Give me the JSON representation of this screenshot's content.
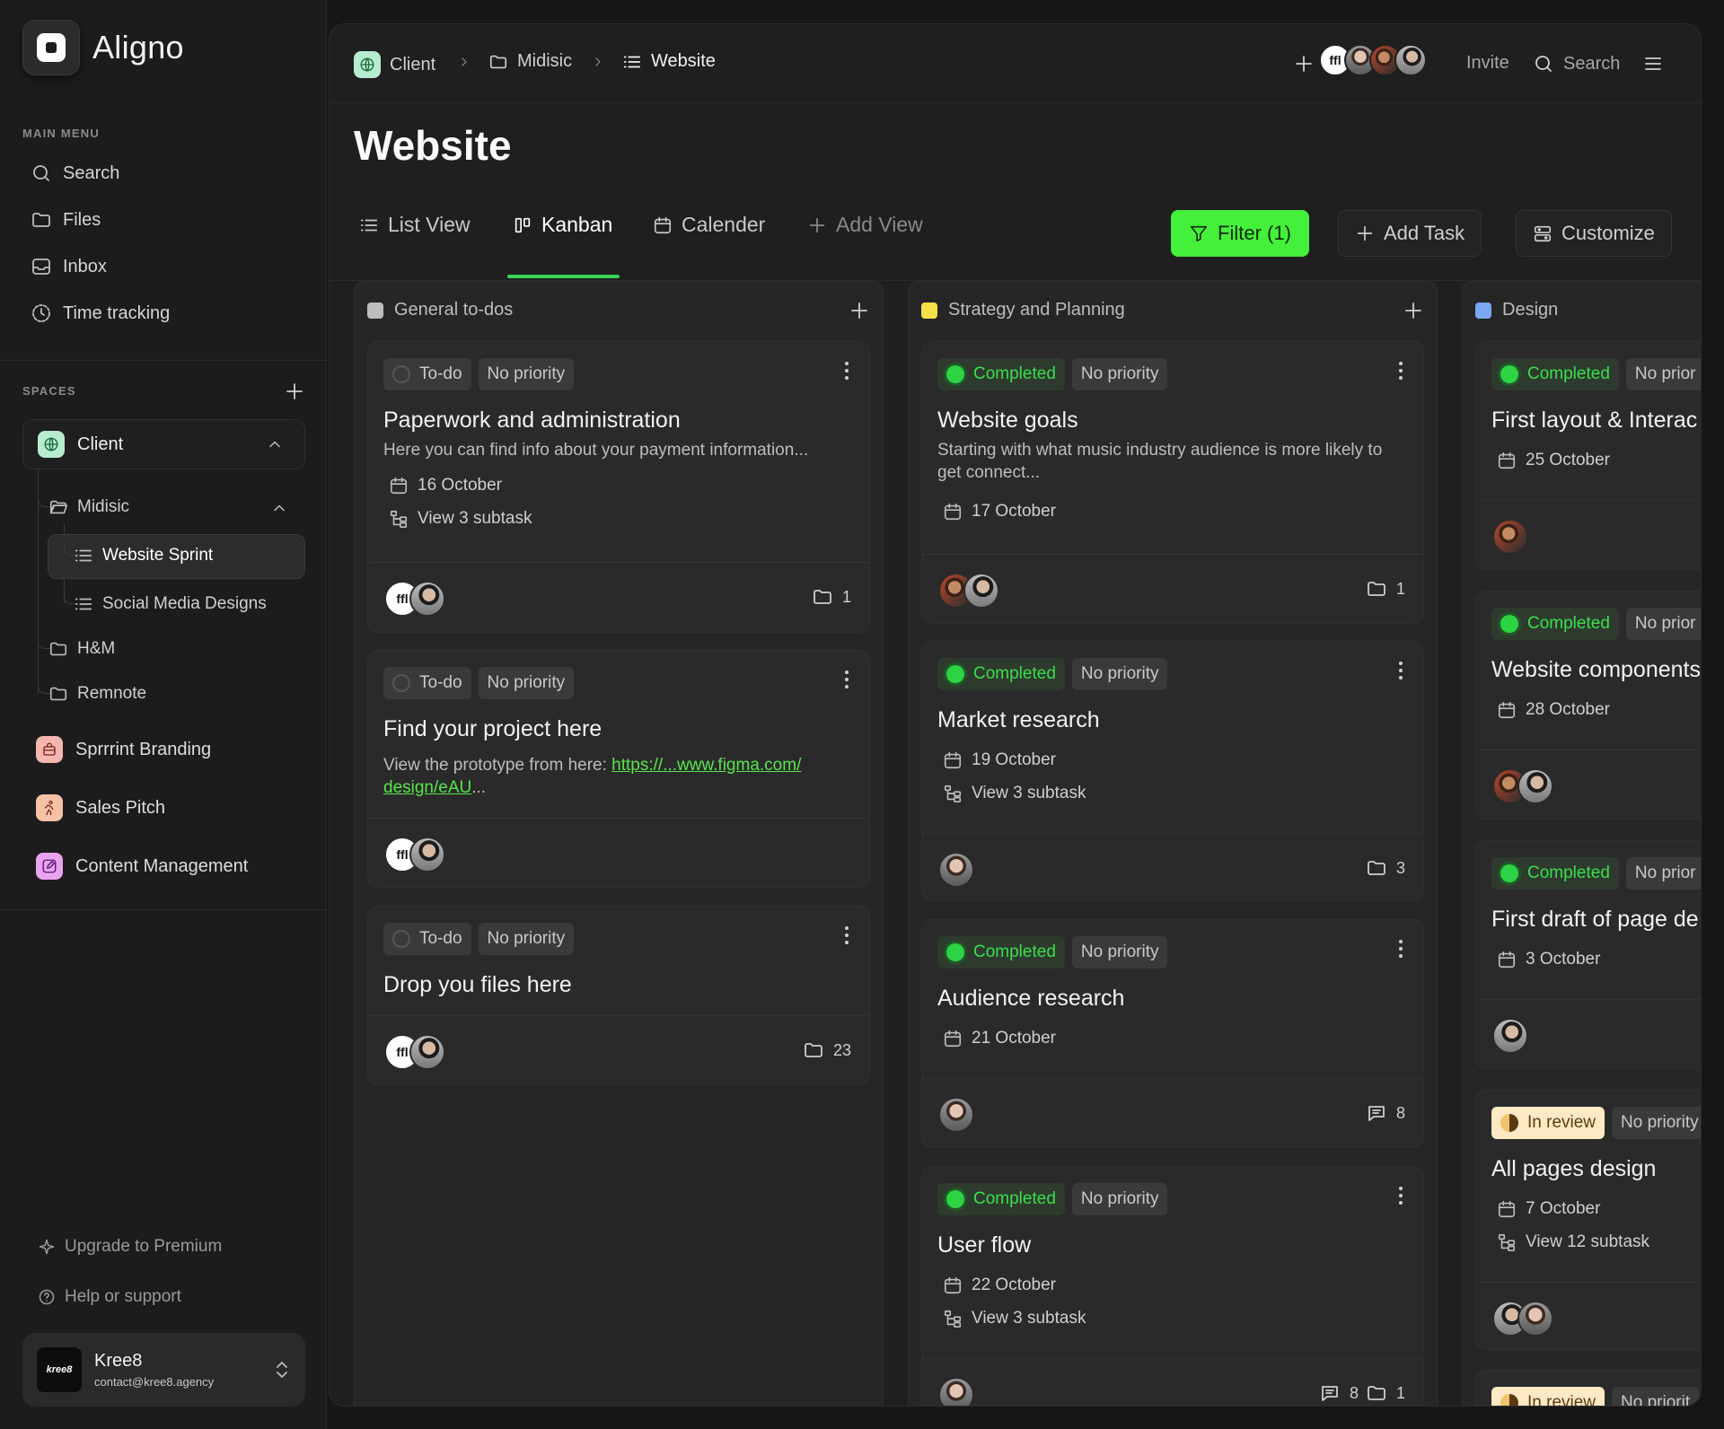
{
  "app": {
    "name": "Aligno"
  },
  "sidebar": {
    "main_menu_label": "MAIN MENU",
    "menu": [
      {
        "label": "Search",
        "icon": "search-icon"
      },
      {
        "label": "Files",
        "icon": "folder-icon"
      },
      {
        "label": "Inbox",
        "icon": "inbox-icon"
      },
      {
        "label": "Time tracking",
        "icon": "clock-icon"
      }
    ],
    "spaces_label": "SPACES",
    "client": {
      "label": "Client"
    },
    "tree": {
      "midisic": "Midisic",
      "website_sprint": "Website Sprint",
      "social_media": "Social Media Designs",
      "hm": "H&M",
      "remnote": "Remnote"
    },
    "spaces": [
      {
        "label": "Sprrrint Branding",
        "color": "#f4b6b0",
        "icon": "bag-icon"
      },
      {
        "label": "Sales Pitch",
        "color": "#f7c1a6",
        "icon": "runner-icon"
      },
      {
        "label": "Content Management",
        "color": "#e9a4f0",
        "icon": "edit-icon"
      }
    ],
    "upgrade": "Upgrade to Premium",
    "help": "Help or support",
    "account": {
      "name": "Kree8",
      "email": "contact@kree8.agency",
      "logo_text": "kree8"
    }
  },
  "topbar": {
    "breadcrumb": [
      "Client",
      "Midisic",
      "Website"
    ],
    "invite": "Invite",
    "search": "Search"
  },
  "page": {
    "title": "Website",
    "tabs": [
      "List View",
      "Kanban",
      "Calender",
      "Add View"
    ],
    "filter_label": "Filter (1)",
    "add_task_label": "Add Task",
    "customize_label": "Customize"
  },
  "columns": [
    {
      "title": "General to-dos",
      "color": "#bdbdbd",
      "cards": [
        {
          "status": "To-do",
          "priority": "No priority",
          "title": "Paperwork and administration",
          "desc": "Here you can find info about your payment information...",
          "date": "16 October",
          "subtask": "View 3 subtask",
          "count": "1"
        },
        {
          "status": "To-do",
          "priority": "No priority",
          "title": "Find your project here",
          "desc_prefix": "View the prototype from here: ",
          "link": "https://...www.figma.com/",
          "link2": "design/eAU",
          "desc_suffix": "..."
        },
        {
          "status": "To-do",
          "priority": "No priority",
          "title": "Drop you files here",
          "count": "23"
        }
      ]
    },
    {
      "title": "Strategy and Planning",
      "color": "#f5e04a",
      "cards": [
        {
          "status": "Completed",
          "priority": "No priority",
          "title": "Website goals",
          "desc": "Starting with what music industry audience is more likely to get connect...",
          "date": "17 October",
          "count": "1"
        },
        {
          "status": "Completed",
          "priority": "No priority",
          "title": "Market research",
          "date": "19 October",
          "subtask": "View 3 subtask",
          "count": "3"
        },
        {
          "status": "Completed",
          "priority": "No priority",
          "title": "Audience research",
          "date": "21 October",
          "comments": "8"
        },
        {
          "status": "Completed",
          "priority": "No priority",
          "title": "User flow",
          "date": "22 October",
          "subtask": "View 3 subtask",
          "comments": "8",
          "count": "1"
        }
      ]
    },
    {
      "title": "Design",
      "color": "#7aa8f5",
      "cards": [
        {
          "status": "Completed",
          "priority": "No prior",
          "title": "First layout & Interac",
          "date": "25 October"
        },
        {
          "status": "Completed",
          "priority": "No prior",
          "title": "Website components",
          "date": "28 October"
        },
        {
          "status": "Completed",
          "priority": "No prior",
          "title": "First draft of page de",
          "date": "3 October"
        },
        {
          "status": "In review",
          "priority": "No priority",
          "title": "All pages design",
          "date": "7 October",
          "subtask": "View 12 subtask"
        },
        {
          "status": "In review",
          "priority": "No priorit"
        }
      ]
    }
  ],
  "colors": {
    "accent": "#44f03a",
    "completed": "#2ed345",
    "review_bg": "#fde9c4"
  }
}
